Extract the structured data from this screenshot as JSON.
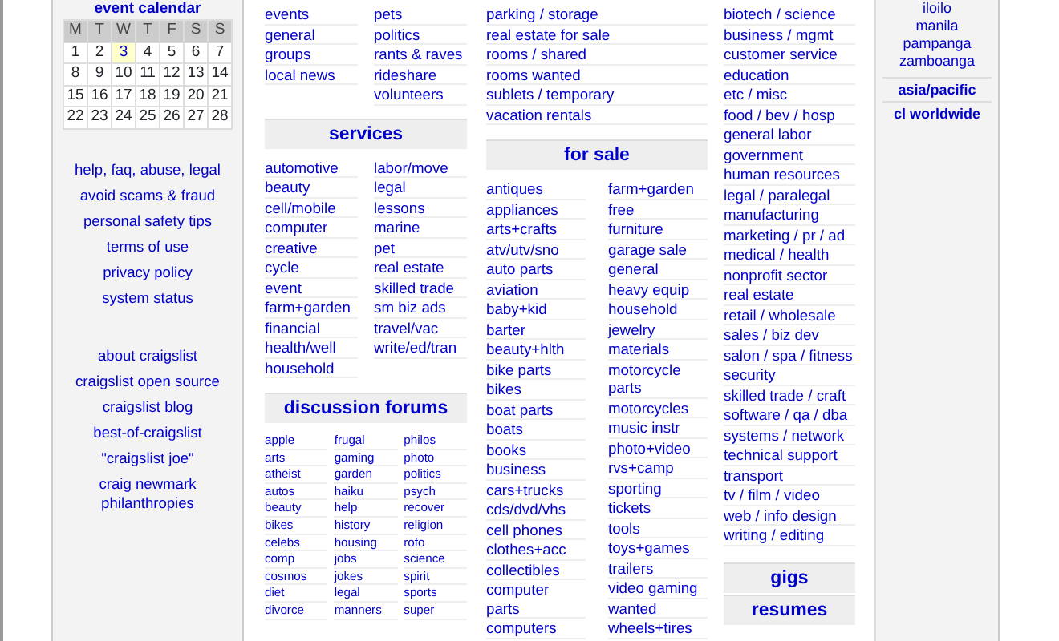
{
  "calendar": {
    "title": "event calendar",
    "weekdays": [
      "M",
      "T",
      "W",
      "T",
      "F",
      "S",
      "S"
    ],
    "days": [
      {
        "label": "1",
        "today": false
      },
      {
        "label": "2",
        "today": false
      },
      {
        "label": "3",
        "today": true
      },
      {
        "label": "4",
        "today": false
      },
      {
        "label": "5",
        "today": false
      },
      {
        "label": "6",
        "today": false
      },
      {
        "label": "7",
        "today": false
      },
      {
        "label": "8",
        "today": false
      },
      {
        "label": "9",
        "today": false
      },
      {
        "label": "10",
        "today": false
      },
      {
        "label": "11",
        "today": false
      },
      {
        "label": "12",
        "today": false
      },
      {
        "label": "13",
        "today": false
      },
      {
        "label": "14",
        "today": false
      },
      {
        "label": "15",
        "today": false
      },
      {
        "label": "16",
        "today": false
      },
      {
        "label": "17",
        "today": false
      },
      {
        "label": "18",
        "today": false
      },
      {
        "label": "19",
        "today": false
      },
      {
        "label": "20",
        "today": false
      },
      {
        "label": "21",
        "today": false
      },
      {
        "label": "22",
        "today": false
      },
      {
        "label": "23",
        "today": false
      },
      {
        "label": "24",
        "today": false
      },
      {
        "label": "25",
        "today": false
      },
      {
        "label": "26",
        "today": false
      },
      {
        "label": "27",
        "today": false
      },
      {
        "label": "28",
        "today": false
      }
    ]
  },
  "help_links": [
    "help, faq, abuse, legal",
    "avoid scams & fraud",
    "personal safety tips",
    "terms of use",
    "privacy policy",
    "system status"
  ],
  "about_links": [
    "about craigslist",
    "craigslist open source",
    "craigslist blog",
    "best-of-craigslist",
    "\"craigslist joe\"",
    "craig newmark philanthropies"
  ],
  "community": {
    "left": [
      "events",
      "general",
      "groups",
      "local news"
    ],
    "right": [
      "pets",
      "politics",
      "rants & raves",
      "rideshare",
      "volunteers"
    ]
  },
  "services": {
    "title": "services",
    "left": [
      "automotive",
      "beauty",
      "cell/mobile",
      "computer",
      "creative",
      "cycle",
      "event",
      "farm+garden",
      "financial",
      "health/well",
      "household"
    ],
    "right": [
      "labor/move",
      "legal",
      "lessons",
      "marine",
      "pet",
      "real estate",
      "skilled trade",
      "sm biz ads",
      "travel/vac",
      "write/ed/tran"
    ]
  },
  "forums": {
    "title": "discussion forums",
    "columns": [
      [
        "apple",
        "arts",
        "atheist",
        "autos",
        "beauty",
        "bikes",
        "celebs",
        "comp",
        "cosmos",
        "diet",
        "divorce"
      ],
      [
        "frugal",
        "gaming",
        "garden",
        "haiku",
        "help",
        "history",
        "housing",
        "jobs",
        "jokes",
        "legal",
        "manners"
      ],
      [
        "philos",
        "photo",
        "politics",
        "psych",
        "recover",
        "religion",
        "rofo",
        "science",
        "spirit",
        "sports",
        "super"
      ]
    ]
  },
  "housing": [
    "parking / storage",
    "real estate for sale",
    "rooms / shared",
    "rooms wanted",
    "sublets / temporary",
    "vacation rentals"
  ],
  "for_sale": {
    "title": "for sale",
    "left": [
      "antiques",
      "appliances",
      "arts+crafts",
      "atv/utv/sno",
      "auto parts",
      "aviation",
      "baby+kid",
      "barter",
      "beauty+hlth",
      "bike parts",
      "bikes",
      "boat parts",
      "boats",
      "books",
      "business",
      "cars+trucks",
      "cds/dvd/vhs",
      "cell phones",
      "clothes+acc",
      "collectibles",
      "computer parts",
      "computers"
    ],
    "right": [
      "farm+garden",
      "free",
      "furniture",
      "garage sale",
      "general",
      "heavy equip",
      "household",
      "jewelry",
      "materials",
      "motorcycle parts",
      "motorcycles",
      "music instr",
      "photo+video",
      "rvs+camp",
      "sporting",
      "tickets",
      "tools",
      "toys+games",
      "trailers",
      "video gaming",
      "wanted",
      "wheels+tires"
    ]
  },
  "jobs": [
    "biotech / science",
    "business / mgmt",
    "customer service",
    "education",
    "etc / misc",
    "food / bev / hosp",
    "general labor",
    "government",
    "human resources",
    "legal / paralegal",
    "manufacturing",
    "marketing / pr / ad",
    "medical / health",
    "nonprofit sector",
    "real estate",
    "retail / wholesale",
    "sales / biz dev",
    "salon / spa / fitness",
    "security",
    "skilled trade / craft",
    "software / qa / dba",
    "systems / network",
    "technical support",
    "transport",
    "tv / film / video",
    "web / info design",
    "writing / editing"
  ],
  "gigs": {
    "title": "gigs"
  },
  "resumes": {
    "title": "resumes"
  },
  "regions": {
    "cities": [
      "iloilo",
      "manila",
      "pampanga",
      "zamboanga"
    ],
    "links": [
      "asia/pacific",
      "cl worldwide"
    ]
  }
}
